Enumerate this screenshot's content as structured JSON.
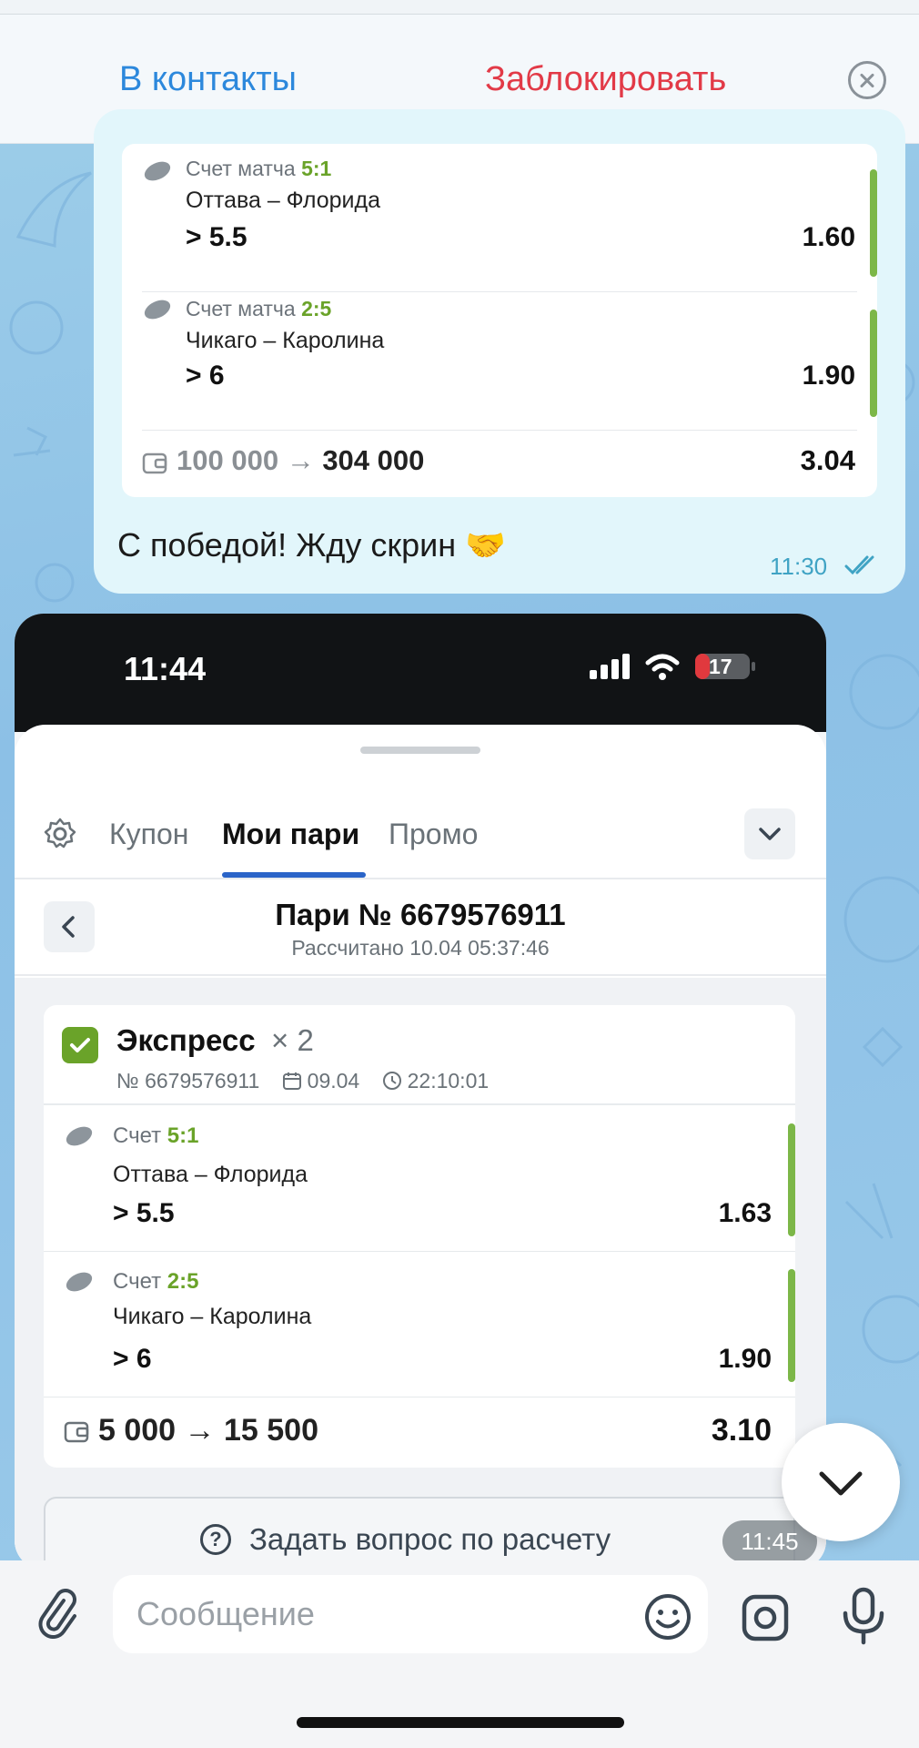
{
  "top_banner": {
    "add_contact_label": "В контакты",
    "block_label": "Заблокировать",
    "close_icon": "close-circle-icon"
  },
  "message": {
    "bet": {
      "legs": [
        {
          "label": "Счет матча",
          "score": "5:1",
          "teams": "Оттава – Флорида",
          "total": "> 5.5",
          "odds": "1.60"
        },
        {
          "label": "Счет матча",
          "score": "2:5",
          "teams": "Чикаго – Каролина",
          "total": "> 6",
          "odds": "1.90"
        }
      ],
      "stake": "100 000",
      "payout": "304 000",
      "total_odds": "3.04"
    },
    "text": "С победой! Жду скрин 🤝",
    "time": "11:30"
  },
  "screenshot": {
    "status_time": "11:44",
    "battery": "17",
    "tabs": [
      "Купон",
      "Мои пари",
      "Промо"
    ],
    "active_tab": "Мои пари",
    "bet_title": "Пари № 6679576911",
    "bet_subtitle": "Рассчитано 10.04 05:37:46",
    "express": {
      "title": "Экспресс",
      "multiplier": "× 2",
      "number": "№ 6679576911",
      "date": "09.04",
      "time": "22:10:01",
      "legs": [
        {
          "label": "Счет",
          "score": "5:1",
          "teams": "Оттава – Флорида",
          "total": "> 5.5",
          "odds": "1.63"
        },
        {
          "label": "Счет",
          "score": "2:5",
          "teams": "Чикаго – Каролина",
          "total": "> 6",
          "odds": "1.90"
        }
      ],
      "stake": "5 000",
      "payout": "15 500",
      "total_odds": "3.10"
    },
    "ask_button": "Задать вопрос по расчету",
    "time": "11:45"
  },
  "composer": {
    "placeholder": "Сообщение"
  },
  "colors": {
    "accent_blue": "#2c88dc",
    "danger_red": "#e23a47",
    "win_green": "#6aa329"
  }
}
